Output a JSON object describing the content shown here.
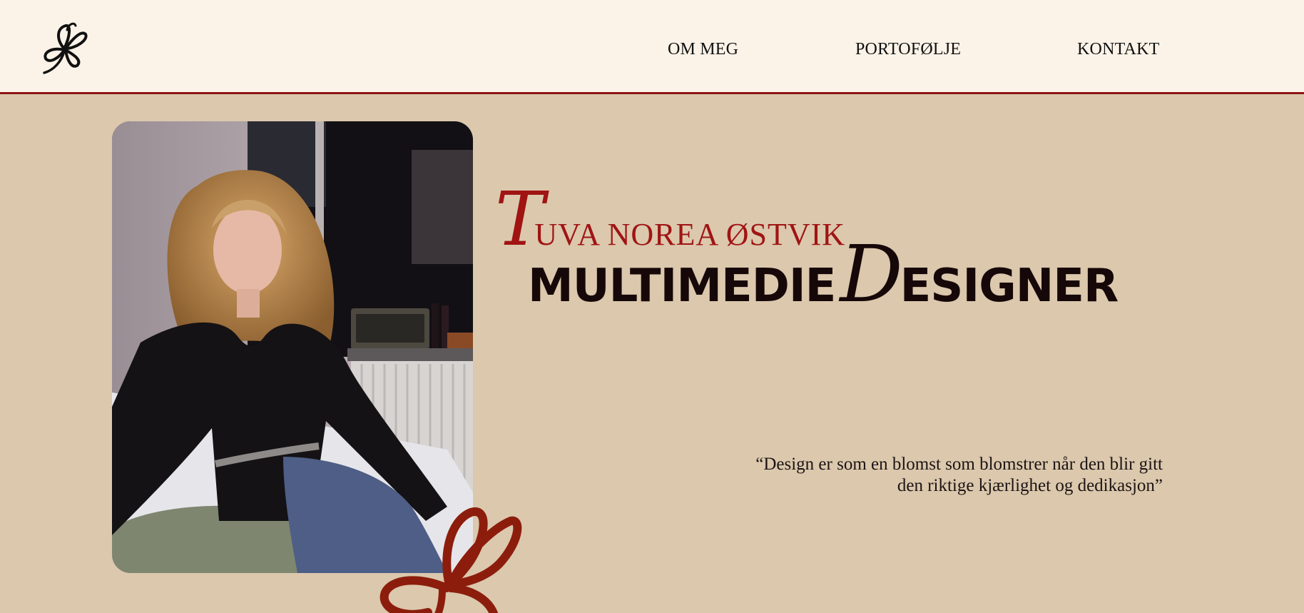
{
  "header": {
    "logo_icon": "flower-sketch-icon",
    "nav": [
      {
        "label": "OM MEG"
      },
      {
        "label": "PORTOFØLJE"
      },
      {
        "label": "KONTAKT"
      }
    ]
  },
  "hero": {
    "name_initial": "T",
    "name_rest": "UVA NOREA ØSTVIK",
    "title_part1": "MULTIMEDIE",
    "title_initial": "D",
    "title_part2": "ESIGNER",
    "quote_line1": "“Design er som en blomst som blomstrer når den blir gitt",
    "quote_line2": "den riktige kjærlighet og dedikasjon”",
    "photo_icon": "portrait-photo",
    "decoration_icon": "red-flower-icon"
  },
  "colors": {
    "header_bg": "#fbf3e8",
    "page_bg": "#dbc8ad",
    "accent_red": "#a01414",
    "divider": "#8f1414",
    "title_dark": "#160808",
    "flower_red": "#8c1d0c"
  }
}
